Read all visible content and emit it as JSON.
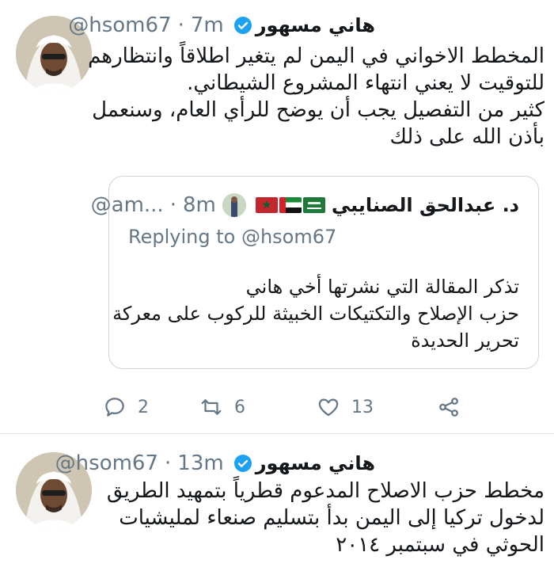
{
  "tweets": [
    {
      "name": "هاني مسهور",
      "handle": "@hsom67",
      "separator": "·",
      "time": "7m",
      "avatar_icon": "avatar-man-ghutra",
      "text_lines": [
        "المخطط الاخواني في اليمن لم يتغير اطلاقاً وانتظارهم",
        "للتوقيت لا يعني انتهاء المشروع الشيطاني.",
        "كثير من التفصيل يجب أن يوضح للرأي العام، وسنعمل",
        "بأذن الله على ذلك"
      ],
      "quoted": {
        "name": "د. عبدالحق الصنايبي",
        "handle": "@am...",
        "separator": "·",
        "time": "8m",
        "flags": [
          "flag-saudi-arabia",
          "flag-uae",
          "flag-morocco"
        ],
        "replying_prefix": "Replying to",
        "replying_to": "@hsom67",
        "text_lines": [
          "تذكر المقالة التي نشرتها أخي هاني",
          "حزب الإصلاح والتكتيكات الخبيثة للركوب على معركة",
          "تحرير الحديدة"
        ]
      },
      "actions": {
        "reply_count": "2",
        "retweet_count": "6",
        "like_count": "13",
        "share_label": ""
      }
    },
    {
      "name": "هاني مسهور",
      "handle": "@hsom67",
      "separator": "·",
      "time": "13m",
      "avatar_icon": "avatar-man-ghutra",
      "text_lines": [
        "مخطط حزب الاصلاح المدعوم قطرياً بتمهيد الطريق",
        "لدخول تركيا إلى اليمن بدأ بتسليم صنعاء لمليشيات",
        "الحوثي في سبتمبر ٢٠١٤"
      ]
    }
  ],
  "colors": {
    "text": "#14171a",
    "secondary": "#657786",
    "verified": "#1da1f2",
    "border": "#e1e8ed"
  }
}
